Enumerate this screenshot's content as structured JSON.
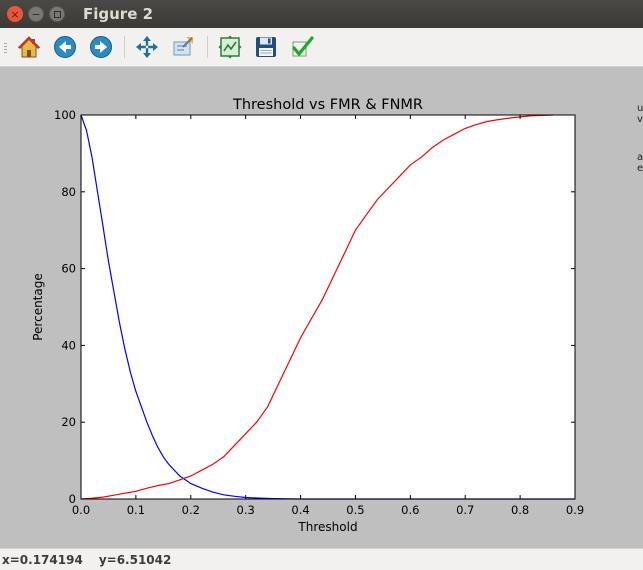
{
  "window": {
    "title": "Figure 2"
  },
  "toolbar": {
    "tools": [
      {
        "name": "home",
        "icon": "home-icon"
      },
      {
        "name": "back",
        "icon": "back-arrow-icon"
      },
      {
        "name": "forward",
        "icon": "forward-arrow-icon"
      },
      {
        "name": "pan",
        "icon": "pan-move-icon"
      },
      {
        "name": "zoom",
        "icon": "zoom-rect-icon"
      },
      {
        "name": "subplots",
        "icon": "configure-subplots-icon"
      },
      {
        "name": "save",
        "icon": "save-floppy-icon"
      },
      {
        "name": "edit",
        "icon": "checkmark-icon"
      }
    ]
  },
  "status": {
    "x": "x=0.174194",
    "y": "y=6.51042"
  },
  "colors": {
    "series1": "#0000ff",
    "series2": "#ff0000",
    "frame": "#bfbfbf"
  },
  "chart_data": {
    "type": "line",
    "title": "Threshold vs FMR & FNMR",
    "xlabel": "Threshold",
    "ylabel": "Percentage",
    "xlim": [
      0,
      0.9
    ],
    "ylim": [
      0,
      100
    ],
    "xticks": [
      "0.0",
      "0.1",
      "0.2",
      "0.3",
      "0.4",
      "0.5",
      "0.6",
      "0.7",
      "0.8",
      "0.9"
    ],
    "yticks": [
      "0",
      "20",
      "40",
      "60",
      "80",
      "100"
    ],
    "grid": false,
    "series": [
      {
        "color": "#0000ff",
        "x": [
          0,
          0.01,
          0.02,
          0.03,
          0.04,
          0.05,
          0.06,
          0.07,
          0.08,
          0.09,
          0.1,
          0.11,
          0.12,
          0.13,
          0.14,
          0.15,
          0.16,
          0.17,
          0.18,
          0.19,
          0.2,
          0.22,
          0.24,
          0.26,
          0.28,
          0.3,
          0.32,
          0.35,
          0.4,
          0.5,
          0.6,
          0.7,
          0.8,
          0.9
        ],
        "y": [
          100,
          96,
          89,
          80,
          71,
          62,
          54,
          46,
          39,
          33,
          28,
          24,
          20,
          16.5,
          13.5,
          11,
          9,
          7.5,
          6,
          5,
          4,
          2.8,
          1.8,
          1.1,
          0.7,
          0.4,
          0.25,
          0.1,
          0,
          0,
          0,
          0,
          0,
          0
        ]
      },
      {
        "color": "#ff0000",
        "x": [
          0,
          0.02,
          0.04,
          0.06,
          0.08,
          0.1,
          0.12,
          0.14,
          0.16,
          0.18,
          0.2,
          0.22,
          0.24,
          0.26,
          0.28,
          0.3,
          0.32,
          0.34,
          0.36,
          0.38,
          0.4,
          0.42,
          0.44,
          0.46,
          0.48,
          0.5,
          0.52,
          0.54,
          0.56,
          0.58,
          0.6,
          0.62,
          0.64,
          0.66,
          0.68,
          0.7,
          0.72,
          0.74,
          0.76,
          0.78,
          0.8,
          0.82,
          0.84,
          0.86
        ],
        "y": [
          0,
          0.2,
          0.5,
          1,
          1.5,
          2,
          2.8,
          3.5,
          4,
          5,
          6,
          7.5,
          9,
          11,
          14,
          17,
          20,
          24,
          30,
          36,
          42,
          47,
          52,
          58,
          64,
          70,
          74,
          78,
          81,
          84,
          87,
          89,
          91.5,
          93.5,
          95,
          96.5,
          97.5,
          98.3,
          98.8,
          99.2,
          99.5,
          99.8,
          99.9,
          100
        ]
      }
    ]
  }
}
